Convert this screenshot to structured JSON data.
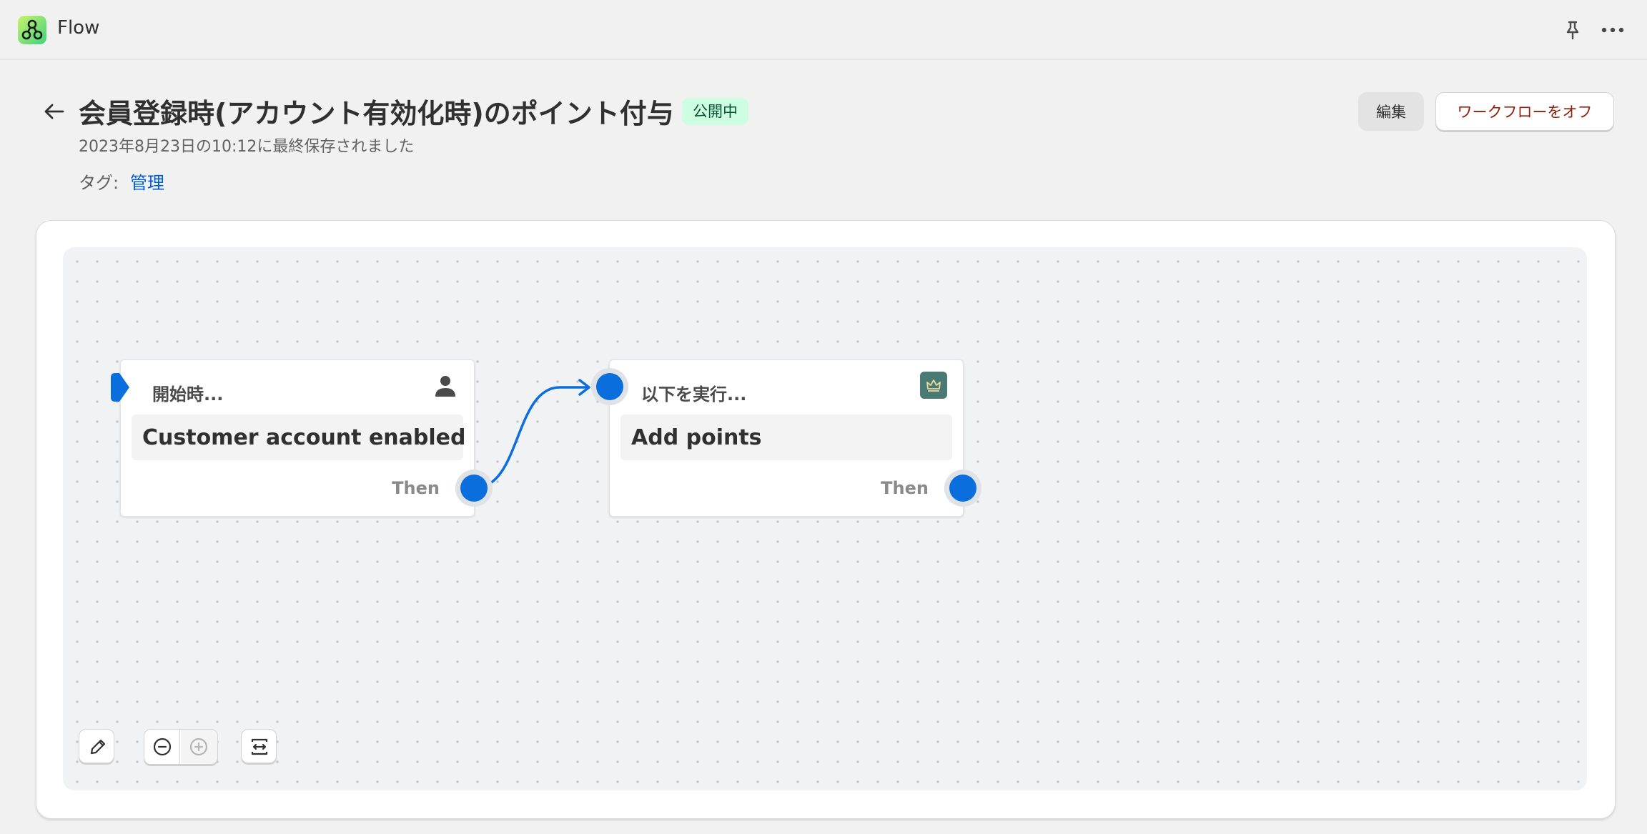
{
  "app": {
    "name": "Flow",
    "logo_icon": "flow-app-icon",
    "logo_color": "#7be33f"
  },
  "topbar": {
    "pin_icon": "pin-icon",
    "more_icon": "more-horizontal-icon"
  },
  "header": {
    "title": "会員登録時(アカウント有効化時)のポイント付与",
    "status": "公開中",
    "last_saved": "2023年8月23日の10:12に最終保存されました",
    "tags_label": "タグ:",
    "tag": "管理",
    "edit_label": "編集",
    "turn_off_label": "ワークフローをオフ"
  },
  "workflow": {
    "trigger": {
      "label": "開始時...",
      "title": "Customer account enabled",
      "then_label": "Then",
      "icon": "customer-icon"
    },
    "action": {
      "label": "以下を実行...",
      "title": "Add points",
      "then_label": "Then",
      "icon": "crown-app-icon"
    }
  },
  "tools": {
    "edit_icon": "pencil-icon",
    "zoom_out_icon": "zoom-out-icon",
    "zoom_in_icon": "zoom-in-icon",
    "fit_icon": "fit-to-screen-icon"
  },
  "colors": {
    "accent": "#0a6fdd",
    "status_bg": "#cdfee1",
    "status_text": "#0c5132",
    "danger_text": "#8e1f0b",
    "link": "#005bd3"
  }
}
